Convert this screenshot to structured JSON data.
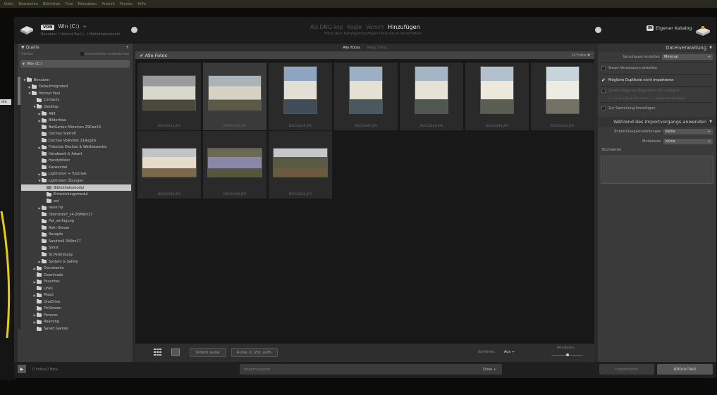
{
  "app_menu": [
    "Datei",
    "Bearbeiten",
    "Bibliothek",
    "Foto",
    "Metadaten",
    "Ansicht",
    "Fenster",
    "Hilfe"
  ],
  "background": {
    "tab_label": "die"
  },
  "topbar": {
    "source_badge": "VON",
    "source_title": "Win (C:)",
    "source_chevron": "÷",
    "source_path": "Benutzer \\ Helmut Paul \\...\\ Bibliotheksmodul",
    "modes": [
      "Als DNG kop",
      "Kopie",
      "Versch",
      "Hinzufügen"
    ],
    "mode_description": "Fotos dem Katalog hinzufügen ohne sie zu verschieben",
    "dest_badge": "IN",
    "dest_title": "Eigener Katalog"
  },
  "left_panel": {
    "title": "Quelle",
    "plus": "+",
    "eject": "Geräte",
    "subfolders_label": "Unterordner einbeziehen",
    "drive": "Win (C:)",
    "tree": [
      {
        "label": "Benutzer",
        "indent": 1,
        "tri": "▼"
      },
      {
        "label": "Defaultmigrated",
        "indent": 2,
        "tri": "▶"
      },
      {
        "label": "Helmut Paul",
        "indent": 2,
        "tri": "▼"
      },
      {
        "label": "Contacts",
        "indent": 3,
        "tri": ""
      },
      {
        "label": "Desktop",
        "indent": 3,
        "tri": "▼"
      },
      {
        "label": "499",
        "indent": 4,
        "tri": "▶"
      },
      {
        "label": "Bilderklau",
        "indent": 4,
        "tri": "▶"
      },
      {
        "label": "BotGarten München 29Dez16",
        "indent": 4,
        "tri": ""
      },
      {
        "label": "Dachau Sternd!",
        "indent": 4,
        "tri": ""
      },
      {
        "label": "Dachau Volksfest 21Aug16",
        "indent": 4,
        "tri": ""
      },
      {
        "label": "Fotoclub Dachau & Wettbewerbe",
        "indent": 4,
        "tri": "▶"
      },
      {
        "label": "Handwerk & Arbeit",
        "indent": 4,
        "tri": ""
      },
      {
        "label": "Handybilder",
        "indent": 4,
        "tri": ""
      },
      {
        "label": "Karwendel",
        "indent": 4,
        "tri": ""
      },
      {
        "label": "Lightroom + Tutorials",
        "indent": 4,
        "tri": "▶"
      },
      {
        "label": "Lightroom Übungen",
        "indent": 4,
        "tri": "▼"
      },
      {
        "label": "Bibliotheksmodul",
        "indent": 5,
        "tri": "",
        "selected": true
      },
      {
        "label": "Entwicklungsmodul",
        "indent": 5,
        "tri": ""
      },
      {
        "label": "ext",
        "indent": 5,
        "tri": ""
      },
      {
        "label": "neue hp",
        "indent": 4,
        "tri": "▶"
      },
      {
        "label": "Oberstdorf_24-26März17",
        "indent": 4,
        "tri": ""
      },
      {
        "label": "Pat_verfügung",
        "indent": 4,
        "tri": ""
      },
      {
        "label": "Rohr Steuer",
        "indent": 4,
        "tri": ""
      },
      {
        "label": "Rezepte",
        "indent": 4,
        "tri": ""
      },
      {
        "label": "Sandizell 5März17",
        "indent": 4,
        "tri": ""
      },
      {
        "label": "Sonst",
        "indent": 4,
        "tri": ""
      },
      {
        "label": "St.Petersburg",
        "indent": 4,
        "tri": ""
      },
      {
        "label": "System & Safety",
        "indent": 4,
        "tri": "▶"
      },
      {
        "label": "Documents",
        "indent": 3,
        "tri": "▶"
      },
      {
        "label": "Downloads",
        "indent": 3,
        "tri": ""
      },
      {
        "label": "Favorites",
        "indent": 3,
        "tri": "▶"
      },
      {
        "label": "Links",
        "indent": 3,
        "tri": ""
      },
      {
        "label": "Music",
        "indent": 3,
        "tri": "▶"
      },
      {
        "label": "OneDrive",
        "indent": 3,
        "tri": ""
      },
      {
        "label": "PicStream",
        "indent": 3,
        "tri": ""
      },
      {
        "label": "Pictures",
        "indent": 3,
        "tri": "▶"
      },
      {
        "label": "Roaming",
        "indent": 3,
        "tri": "▶"
      },
      {
        "label": "Saved Games",
        "indent": 3,
        "tri": ""
      }
    ]
  },
  "center": {
    "view_tabs": [
      "Alle Fotos",
      "Neue Fotos"
    ],
    "grid_title": "Alle Fotos",
    "photo_count": "10 Fotos",
    "photos": [
      {
        "name": "DSC03445.JPG",
        "sky": "#9a9a9a",
        "body": "#d8d8cc",
        "ground": "#4a4a3c",
        "portrait": false,
        "selected": false
      },
      {
        "name": "DSC03445.JPG",
        "sky": "#aab4b8",
        "body": "#d6d2c4",
        "ground": "#5a5a46",
        "portrait": false,
        "selected": true
      },
      {
        "name": "DSC03446.JPG",
        "sky": "#8ea4c0",
        "body": "#e2e0d4",
        "ground": "#404c58",
        "portrait": true,
        "selected": false
      },
      {
        "name": "DSC03447.JPG",
        "sky": "#9cb0c4",
        "body": "#e4e0d2",
        "ground": "#4a5860",
        "portrait": true,
        "selected": false
      },
      {
        "name": "DSC03448.JPG",
        "sky": "#a4b6c6",
        "body": "#e6e2d6",
        "ground": "#505650",
        "portrait": true,
        "selected": false
      },
      {
        "name": "DSC03449.JPG",
        "sky": "#b2c0cc",
        "body": "#ece8dc",
        "ground": "#5a5e52",
        "portrait": true,
        "selected": false
      },
      {
        "name": "DSC03450.JPG",
        "sky": "#c8d4dc",
        "body": "#ecece4",
        "ground": "#727266",
        "portrait": true,
        "selected": false
      },
      {
        "name": "DSC03506.JPG",
        "sky": "#c0c4c6",
        "body": "#e4dcc8",
        "ground": "#7a6a4a",
        "portrait": false,
        "selected": false
      },
      {
        "name": "DSC03509.JPG",
        "sky": "#6a6a50",
        "body": "#8a86a8",
        "ground": "#56563a",
        "portrait": false,
        "selected": false
      },
      {
        "name": "DSC03523.JPG",
        "sky": "#c4c8c8",
        "body": "#5a5a44",
        "ground": "#6a5a3e",
        "portrait": false,
        "selected": false
      }
    ],
    "toolbar": {
      "video_btn": "Videos ausw.",
      "video_btn2": "Ausw. d. Vid. aufh.",
      "sort_label": "Sortieren:",
      "sort_value": "Aus ÷",
      "thumb_label": "Miniaturen"
    }
  },
  "right_panel": {
    "title": "Dateiverwaltung",
    "preview_label": "Vorschauen erstellen",
    "preview_value": "Minimal",
    "smart_preview": "Smart-Vorschauen erstellen",
    "no_duplicates": "Mögliche Duplikate nicht importieren",
    "second_copy": "Zweite Kopie an folgendem Ort anlegen:",
    "second_copy_path": "C: \\ User \\ Paul \\ Pictures \\ ...\\ Download-Backups",
    "add_to_collection": "Zur Sammlung hinzufügen",
    "during_import_title": "Während des Importvorgangs anwenden",
    "dev_settings_label": "Entwicklungseinstellungen",
    "dev_settings_value": "Keine",
    "metadata_label": "Metadaten",
    "metadata_value": "Keine",
    "keywords_label": "Stichwörter"
  },
  "footer": {
    "expand": "▶",
    "status": "0 Fotos/0 Byte",
    "preset_label": "Importvorgabe:",
    "preset_value": "Ohne ÷",
    "import_btn": "Importieren",
    "cancel_btn": "Abbrechen"
  }
}
